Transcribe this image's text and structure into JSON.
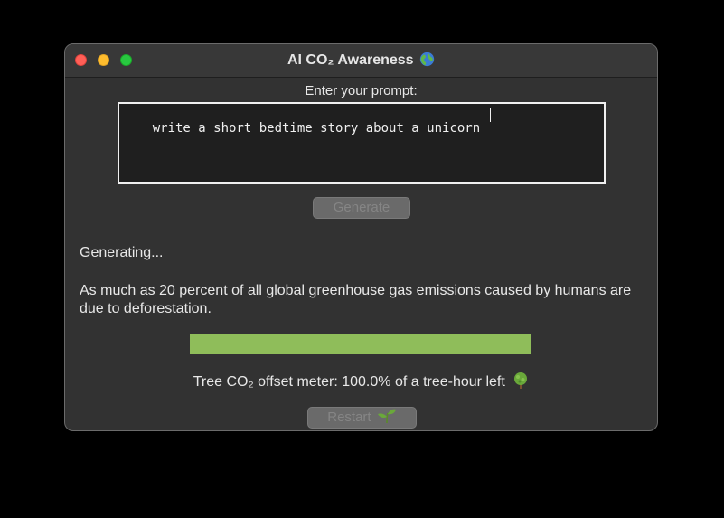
{
  "window": {
    "title": "AI CO₂ Awareness",
    "title_icon": "globe-icon"
  },
  "prompt": {
    "label": "Enter your prompt:",
    "value": "write a short bedtime story about a unicorn"
  },
  "generate_button": {
    "label": "Generate"
  },
  "status": {
    "text": "Generating..."
  },
  "fact": {
    "text": "As much as 20 percent of all global greenhouse gas emissions caused by humans are due to deforestation."
  },
  "meter": {
    "label": "Tree CO₂ offset meter: 100.0% of a tree-hour left",
    "icon": "tree-icon",
    "fill_fraction": 1.0,
    "fill_color": "#8fbd5a"
  },
  "restart_button": {
    "label": "Restart",
    "icon": "sprout-icon"
  },
  "colors": {
    "window_bg": "#323232",
    "close": "#ff5f57",
    "minimize": "#febc2e",
    "maximize": "#28c840"
  }
}
